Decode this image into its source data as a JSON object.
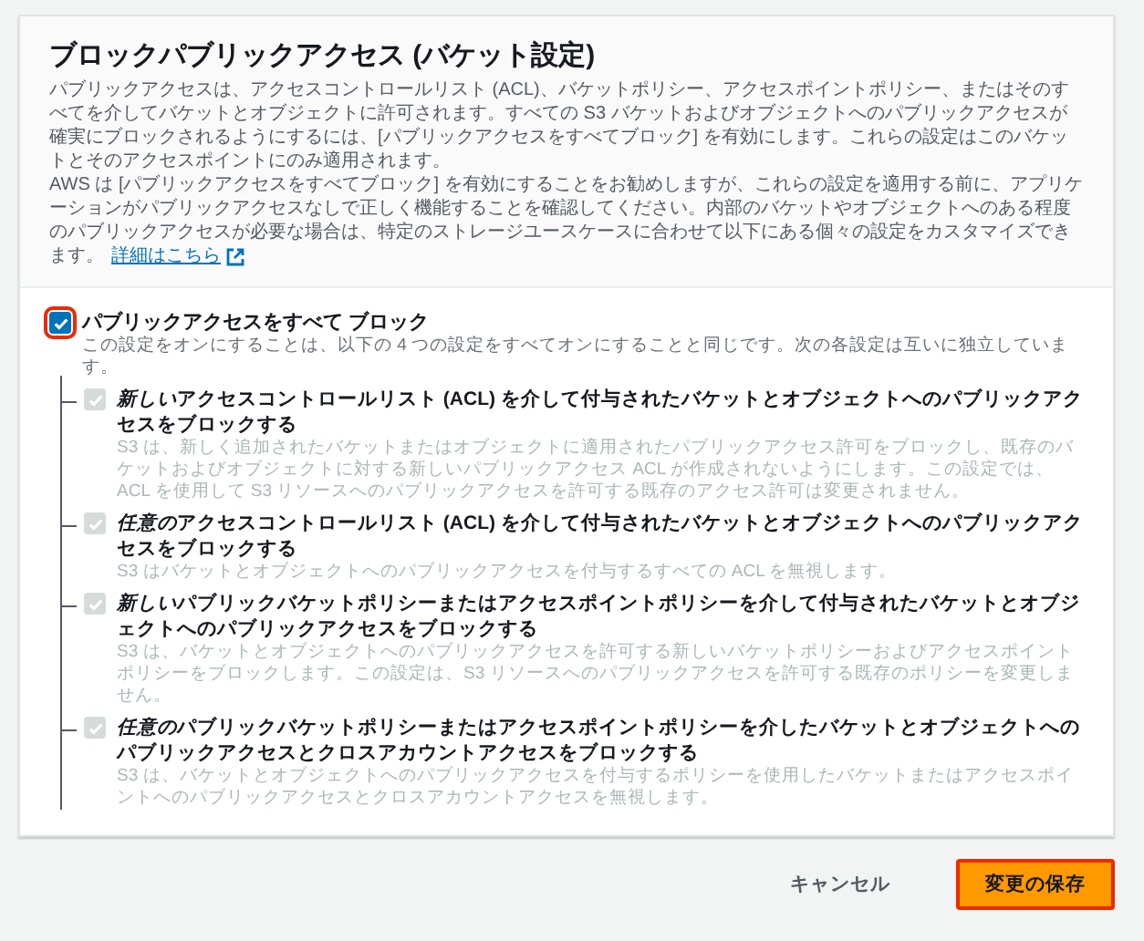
{
  "panel": {
    "title": "ブロックパブリックアクセス (バケット設定)",
    "description": [
      "パブリックアクセスは、アクセスコントロールリスト (ACL)、バケットポリシー、アクセスポイントポリシー、またはそのすべてを介してバケットとオブジェクトに許可されます。すべての S3 バケットおよびオブジェクトへのパブリックアクセスが確実にブロックされるようにするには、[パブリックアクセスをすべてブロック] を有効にします。これらの設定はこのバケットとそのアクセスポイントにのみ適用されます。",
      "AWS は [パブリックアクセスをすべてブロック] を有効にすることをお勧めしますが、これらの設定を適用する前に、アプリケーションがパブリックアクセスなしで正しく機能することを確認してください。内部のバケットやオブジェクトへのある程度のパブリックアクセスが必要な場合は、特定のストレージユースケースに合わせて以下にある個々の設定をカスタマイズできます。"
    ],
    "link": "詳細はこちら"
  },
  "block_all": {
    "label": "パブリックアクセスをすべて ブロック",
    "checked": true,
    "focused": true,
    "description": "この設定をオンにすることは、以下の 4 つの設定をすべてオンにすることと同じです。次の各設定は互いに独立しています。",
    "children": [
      {
        "emphasis": "新しい",
        "label": "アクセスコントロールリスト (ACL) を介して付与されたバケットとオブジェクトへのパブリックアクセスをブロックする",
        "checked": true,
        "disabled": true,
        "description": "S3 は、新しく追加されたバケットまたはオブジェクトに適用されたパブリックアクセス許可をブロックし、既存のバケットおよびオブジェクトに対する新しいパブリックアクセス ACL が作成されないようにします。この設定では、ACL を使用して S3 リソースへのパブリックアクセスを許可する既存のアクセス許可は変更されません。"
      },
      {
        "emphasis": "任意の",
        "label": "アクセスコントロールリスト (ACL) を介して付与されたバケットとオブジェクトへのパブリックアクセスをブロックする",
        "checked": true,
        "disabled": true,
        "description": "S3 はバケットとオブジェクトへのパブリックアクセスを付与するすべての ACL を無視します。"
      },
      {
        "emphasis": "新しい",
        "label": "パブリックバケットポリシーまたはアクセスポイントポリシーを介して付与されたバケットとオブジェクトへのパブリックアクセスをブロックする",
        "checked": true,
        "disabled": true,
        "description": "S3 は、バケットとオブジェクトへのパブリックアクセスを許可する新しいバケットポリシーおよびアクセスポイントポリシーをブロックします。この設定は、S3 リソースへのパブリックアクセスを許可する既存のポリシーを変更しません。"
      },
      {
        "emphasis": "任意の",
        "label": "パブリックバケットポリシーまたはアクセスポイントポリシーを介したバケットとオブジェクトへのパブリックアクセスとクロスアカウントアクセスをブロックする",
        "checked": true,
        "disabled": true,
        "description": "S3 は、バケットとオブジェクトへのパブリックアクセスを付与するポリシーを使用したバケットまたはアクセスポイントへのパブリックアクセスとクロスアカウントアクセスを無視します。"
      }
    ]
  },
  "buttons": [
    {
      "label": "キャンセル",
      "kind": "link"
    },
    {
      "label": "変更の保存",
      "kind": "primary"
    }
  ]
}
